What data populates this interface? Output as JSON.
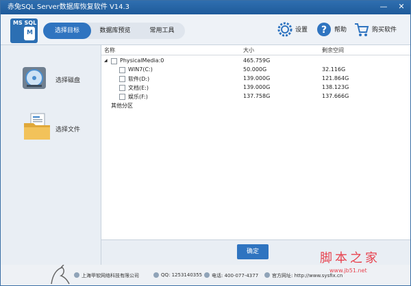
{
  "window": {
    "title": "赤兔SQL Server数据库恢复软件 V14.3",
    "minimize": "—",
    "close": "✕"
  },
  "logo": {
    "top": "MS SQL",
    "letter": "M"
  },
  "tabs": [
    {
      "label": "选择目标",
      "active": true
    },
    {
      "label": "数据库预览",
      "active": false
    },
    {
      "label": "常用工具",
      "active": false
    }
  ],
  "header_buttons": {
    "settings": "设置",
    "help": "帮助",
    "buy": "购买软件"
  },
  "sidebar": {
    "items": [
      {
        "label": "选择磁盘"
      },
      {
        "label": "选择文件"
      }
    ]
  },
  "table": {
    "columns": [
      "名称",
      "大小",
      "剩余空间"
    ],
    "root": {
      "name": "PhysicalMedia:0",
      "size": "465.759G",
      "free": ""
    },
    "rows": [
      {
        "name": "WIN7(C:)",
        "size": "50.000G",
        "free": "32.116G"
      },
      {
        "name": "软件(D:)",
        "size": "139.000G",
        "free": "121.864G"
      },
      {
        "name": "文档(E:)",
        "size": "139.000G",
        "free": "138.123G"
      },
      {
        "name": "娱乐(F:)",
        "size": "137.758G",
        "free": "137.666G"
      }
    ],
    "other": "其他分区"
  },
  "ok_button": "确定",
  "status": {
    "company": "上海甲软网络科技有限公司",
    "qq": "QQ: 1253140355",
    "phone": "电话: 400-077-4377",
    "site": "官方网址: http://www.sysfix.cn"
  },
  "watermark": {
    "line1": "脚本之家",
    "line2": "www.jb51.net"
  },
  "colors": {
    "accent": "#2f74c0",
    "titlebar": "#1e5a9a"
  }
}
